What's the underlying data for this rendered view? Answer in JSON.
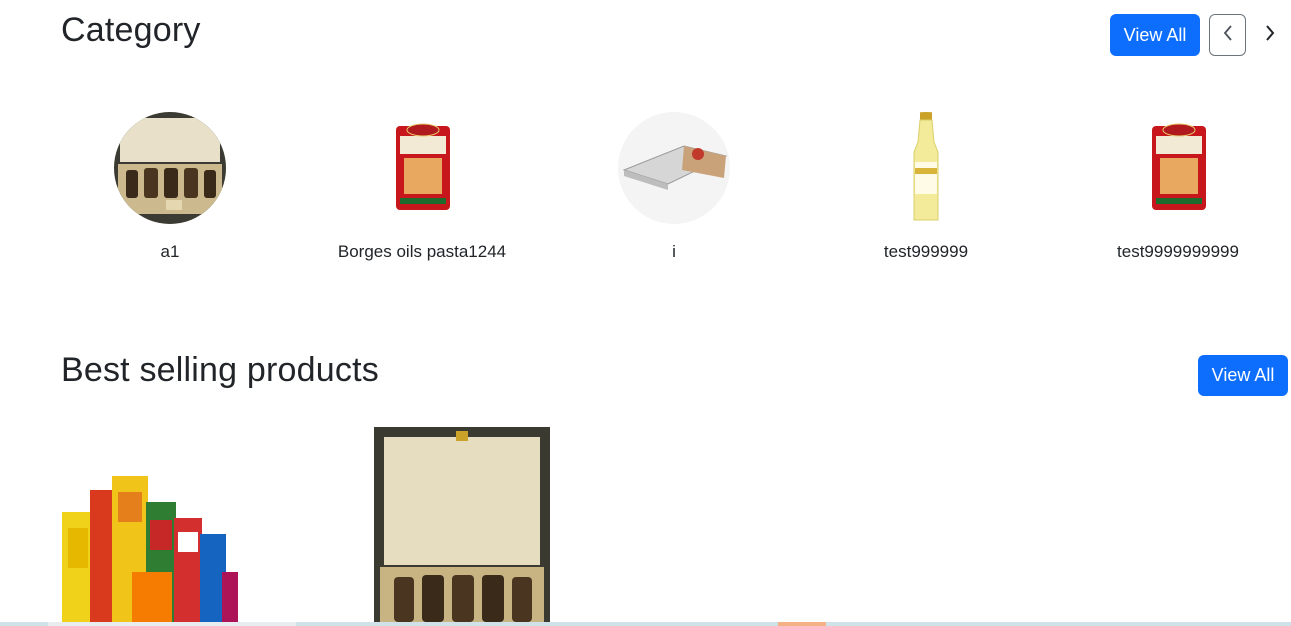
{
  "category": {
    "title": "Category",
    "view_all_label": "View All",
    "prev_glyph": "‹",
    "next_glyph": "›",
    "items": [
      {
        "label": "a1",
        "icon": "gift-box-image"
      },
      {
        "label": "Borges oils pasta1244",
        "icon": "pasta-pack-image"
      },
      {
        "label": "i",
        "icon": "tray-box-image"
      },
      {
        "label": "test999999",
        "icon": "oil-bottle-image"
      },
      {
        "label": "test9999999999",
        "icon": "pasta-pack-image"
      }
    ]
  },
  "best_selling": {
    "title": "Best selling products",
    "view_all_label": "View All",
    "products": [
      {
        "icon": "grocery-assortment-image"
      },
      {
        "icon": "gift-box-image"
      }
    ]
  },
  "colors": {
    "primary": "#0d6efd",
    "text": "#212529"
  }
}
